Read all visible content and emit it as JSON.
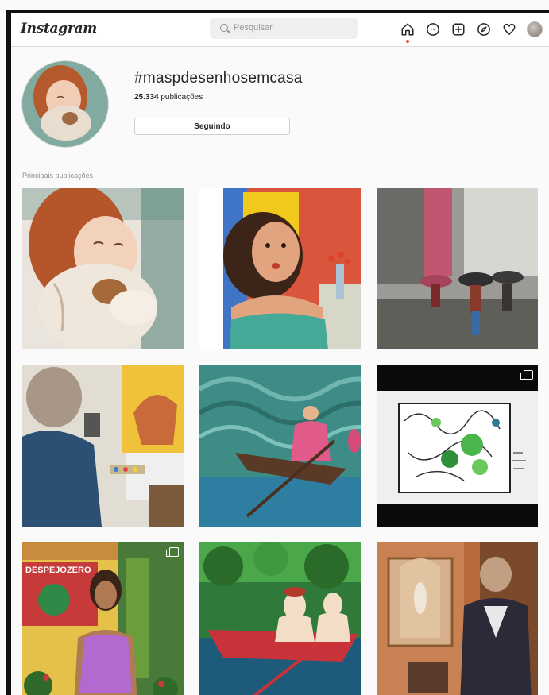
{
  "header": {
    "logo": "Instagram",
    "search_placeholder": "Pesquisar",
    "nav_icons": [
      "home-icon",
      "messenger-icon",
      "new-post-icon",
      "explore-icon",
      "activity-heart-icon",
      "profile-avatar"
    ]
  },
  "hashtag": {
    "title": "#maspdesenhosemcasa",
    "post_count": "25.334",
    "post_label": "publicações",
    "follow_label": "Seguindo"
  },
  "section": {
    "title": "Principais publicações"
  },
  "posts": [
    {
      "subject": "watercolor girl hugging puppy"
    },
    {
      "subject": "illustrated woman in green dress with flowers"
    },
    {
      "subject": "painted rainy street with umbrellas"
    },
    {
      "subject": "person painting horse at easel",
      "blurred_face": true
    },
    {
      "subject": "woman in pink dress rowing boat"
    },
    {
      "subject": "ink drawing of leaves and green fruits",
      "multiple": true
    },
    {
      "subject": "illustrated woman in purple top with banner text DESPEJOZERO",
      "multiple": true
    },
    {
      "subject": "two women in red boat on lake"
    },
    {
      "subject": "man in suit beside ornate altar",
      "blurred_face": true
    }
  ],
  "artwork_text": {
    "banner": "DESPEJOZERO"
  },
  "colors": {
    "notification_dot": "#ed4956",
    "border": "#dbdbdb"
  }
}
